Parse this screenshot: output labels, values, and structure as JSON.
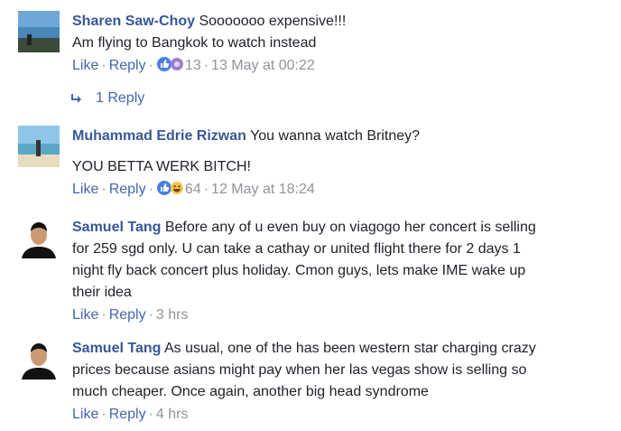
{
  "comments": [
    {
      "author": "Sharen Saw-Choy",
      "lines": [
        "Sooooooo expensive!!!",
        "Am flying to Bangkok to watch instead"
      ],
      "like": "Like",
      "reply": "Reply",
      "reactions": [
        "like-icon",
        "wow-icon"
      ],
      "count": "13",
      "time": "13 May at 00:22"
    },
    {
      "author": "Muhammad Edrie Rizwan",
      "lines": [
        "You wanna watch Britney?",
        "YOU BETTA WERK BITCH!"
      ],
      "like": "Like",
      "reply": "Reply",
      "reactions": [
        "like-icon",
        "haha-icon"
      ],
      "count": "64",
      "time": "12 May at 18:24"
    },
    {
      "author": "Samuel Tang",
      "lines": [
        "Before any of u even buy on viagogo her concert is selling",
        "for 259 sgd only. U can take a cathay or united flight there for 2 days 1",
        "night fly back concert plus holiday. Cmon guys, lets make IME wake up",
        "their idea"
      ],
      "like": "Like",
      "reply": "Reply",
      "time": "3 hrs"
    },
    {
      "author": "Samuel Tang",
      "lines": [
        "As usual, one of the has been western star charging crazy",
        "prices because asians might pay when her las vegas show is selling so",
        "much cheaper. Once again, another big head syndrome"
      ],
      "like": "Like",
      "reply": "Reply",
      "time": "4 hrs"
    }
  ],
  "replies_link": {
    "label": "1 Reply",
    "icon": "reply-arrow-icon"
  },
  "colors": {
    "link": "#365899",
    "action": "#4267b2",
    "meta": "#90949c",
    "text": "#1d2129"
  }
}
